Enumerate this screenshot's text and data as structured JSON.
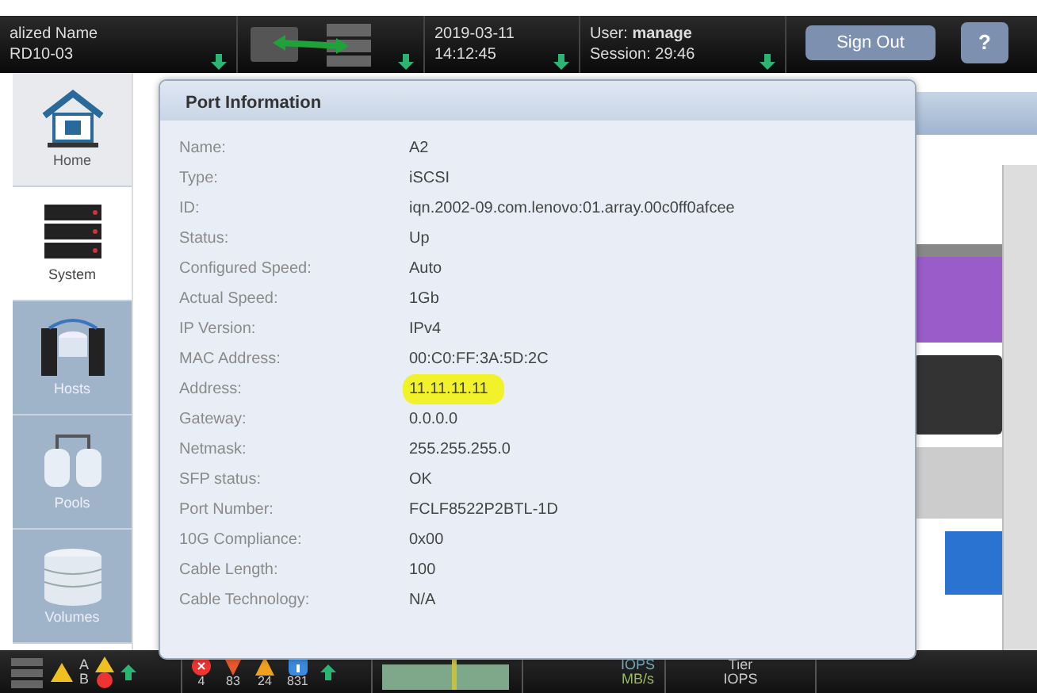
{
  "header": {
    "system_name": "alized Name",
    "system_id": "RD10-03",
    "date": "2019-03-11",
    "time": "14:12:45",
    "user_label": "User:",
    "user": "manage",
    "session_label": "Session:",
    "session": "29:46",
    "sign_out": "Sign Out",
    "help": "?"
  },
  "sidebar": {
    "items": [
      {
        "label": "Home",
        "kind": "home",
        "selected": false
      },
      {
        "label": "System",
        "kind": "system",
        "selected": true
      },
      {
        "label": "Hosts",
        "kind": "hosts",
        "selected": false
      },
      {
        "label": "Pools",
        "kind": "pools",
        "selected": false
      },
      {
        "label": "Volumes",
        "kind": "volumes",
        "selected": false
      }
    ]
  },
  "popup": {
    "title": "Port Information",
    "rows": [
      {
        "label": "Name:",
        "value": "A2",
        "highlighted": false
      },
      {
        "label": "Type:",
        "value": "iSCSI",
        "highlighted": false
      },
      {
        "label": "ID:",
        "value": "iqn.2002-09.com.lenovo:01.array.00c0ff0afcee",
        "highlighted": false
      },
      {
        "label": "Status:",
        "value": "Up",
        "highlighted": false
      },
      {
        "label": "Configured Speed:",
        "value": "Auto",
        "highlighted": false
      },
      {
        "label": "Actual Speed:",
        "value": "1Gb",
        "highlighted": false
      },
      {
        "label": "IP Version:",
        "value": "IPv4",
        "highlighted": false
      },
      {
        "label": "MAC Address:",
        "value": "00:C0:FF:3A:5D:2C",
        "highlighted": false
      },
      {
        "label": "Address:",
        "value": "11.11.11.11",
        "highlighted": true
      },
      {
        "label": "Gateway:",
        "value": "0.0.0.0",
        "highlighted": false
      },
      {
        "label": "Netmask:",
        "value": "255.255.255.0",
        "highlighted": false
      },
      {
        "label": "SFP status:",
        "value": "OK",
        "highlighted": false
      },
      {
        "label": "Port Number:",
        "value": "FCLF8522P2BTL-1D",
        "highlighted": false
      },
      {
        "label": "10G Compliance:",
        "value": "0x00",
        "highlighted": false
      },
      {
        "label": "Cable Length:",
        "value": "100",
        "highlighted": false
      },
      {
        "label": "Cable Technology:",
        "value": "N/A",
        "highlighted": false
      }
    ]
  },
  "status_bar": {
    "controller_a": "A",
    "controller_b": "B",
    "counts": [
      {
        "kind": "error",
        "value": "4"
      },
      {
        "kind": "critical",
        "value": "83"
      },
      {
        "kind": "warning",
        "value": "24"
      },
      {
        "kind": "info",
        "value": "831"
      }
    ],
    "perf_label_1": "IOPS",
    "perf_label_2": "MB/s",
    "tier_label_1": "Tier",
    "tier_label_2": "IOPS"
  }
}
